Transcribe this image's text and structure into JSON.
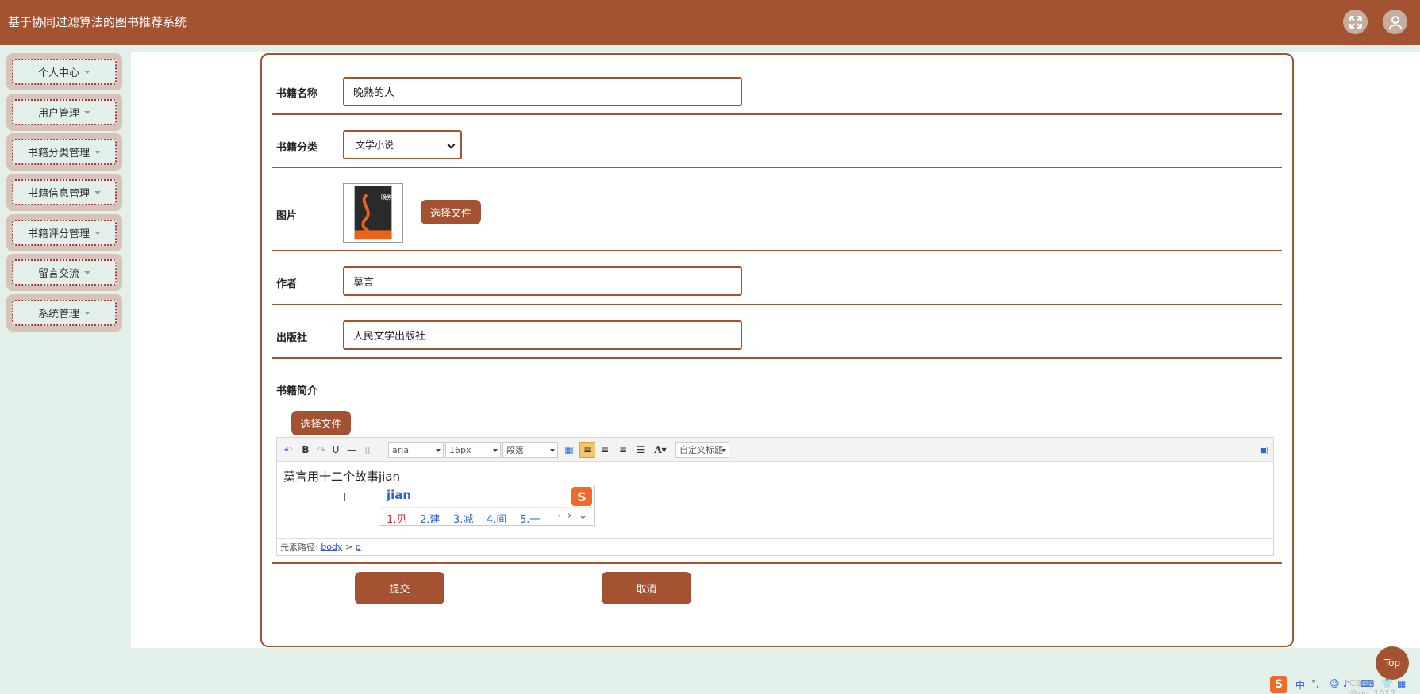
{
  "app": {
    "title": "基于协同过滤算法的图书推荐系统"
  },
  "header_icons": [
    "fullscreen-icon",
    "user-avatar-icon"
  ],
  "sidebar": {
    "items": [
      {
        "label": "个人中心"
      },
      {
        "label": "用户管理"
      },
      {
        "label": "书籍分类管理"
      },
      {
        "label": "书籍信息管理"
      },
      {
        "label": "书籍评分管理"
      },
      {
        "label": "留言交流"
      },
      {
        "label": "系统管理"
      }
    ]
  },
  "form": {
    "book_name": {
      "label": "书籍名称",
      "value": "晚熟的人"
    },
    "category": {
      "label": "书籍分类",
      "value": "文学小说"
    },
    "image": {
      "label": "图片",
      "button": "选择文件",
      "cover_title": "晚熟的人"
    },
    "author": {
      "label": "作者",
      "value": "莫言"
    },
    "publisher": {
      "label": "出版社",
      "value": "人民文学出版社"
    },
    "intro": {
      "label": "书籍简介",
      "button": "选择文件",
      "toolbar": {
        "font": "arial",
        "size": "16px",
        "paragraph": "段落",
        "custom_title": "自定义标题"
      },
      "content": "莫言用十二个故事jian",
      "path_prefix": "元素路径:",
      "path_body": "body",
      "path_sep": ">",
      "path_p": "p"
    },
    "submit": "提交",
    "cancel": "取消"
  },
  "ime": {
    "composition": "jian",
    "candidates": [
      "1.见",
      "2.建",
      "3.减",
      "4.间",
      "5.一"
    ]
  },
  "top_button": "Top",
  "tray": {
    "lang": "中",
    "punct": "°,",
    "watermark": "CSDN @qq_1017"
  },
  "colors": {
    "brand": "#a35331",
    "background": "#e3efe9",
    "ime_blue": "#2a63d6",
    "ime_red": "#d62c2c"
  }
}
